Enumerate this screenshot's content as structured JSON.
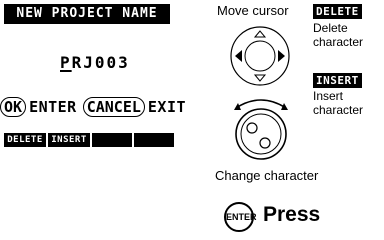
{
  "lcd": {
    "title": "NEW PROJECT NAME",
    "project_name_first": "P",
    "project_name_rest": "RJ003",
    "ok_key": "OK",
    "ok_action": "ENTER",
    "cancel_key": "CANCEL",
    "cancel_action": "EXIT",
    "function_keys": [
      "DELETE",
      "INSERT",
      "",
      ""
    ]
  },
  "guide": {
    "move_cursor": "Move cursor",
    "delete_badge": "DELETE",
    "delete_desc_1": "Delete",
    "delete_desc_2": "character",
    "insert_badge": "INSERT",
    "insert_desc_1": "Insert",
    "insert_desc_2": "character",
    "change_character": "Change character",
    "enter_button": "ENTER",
    "press": "Press"
  }
}
